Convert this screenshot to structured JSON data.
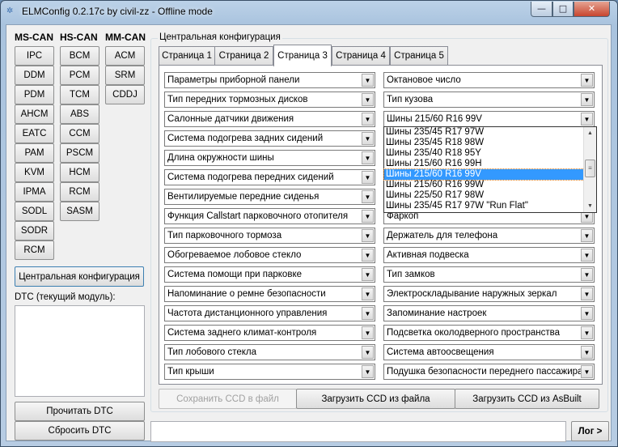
{
  "window": {
    "title": "ELMConfig 0.2.17c by civil-zz - Offline mode",
    "min": "—",
    "max": "□",
    "close": "✕"
  },
  "modules": {
    "ms_can": {
      "label": "MS-CAN",
      "items": [
        "IPC",
        "DDM",
        "PDM",
        "AHCM",
        "EATC",
        "PAM",
        "KVM",
        "IPMA",
        "SODL",
        "SODR",
        "RCM"
      ]
    },
    "hs_can": {
      "label": "HS-CAN",
      "items": [
        "BCM",
        "PCM",
        "TCM",
        "ABS",
        "CCM",
        "PSCM",
        "HCM",
        "RCM",
        "SASM"
      ]
    },
    "mm_can": {
      "label": "MM-CAN",
      "items": [
        "ACM",
        "SRM",
        "CDDJ"
      ]
    }
  },
  "left": {
    "central_config_button": "Центральная конфигурация",
    "dtc_label": "DTC (текущий модуль):",
    "dtc_text": "",
    "read_dtc": "Прочитать DTC",
    "reset_dtc": "Сбросить DTC"
  },
  "group": {
    "label": "Центральная конфигурация",
    "tabs": [
      "Страница 1",
      "Страница 2",
      "Страница 3",
      "Страница 4",
      "Страница 5"
    ],
    "selected_tab": 2,
    "left_combos": [
      "Параметры приборной панели",
      "Тип передних тормозных дисков",
      "Салонные датчики движения",
      "Система подогрева задних сидений",
      "Длина окружности шины",
      "Система подогрева передних сидений",
      "Вентилируемые передние сиденья",
      "Функция Callstart парковочного отопителя",
      "Тип парковочного тормоза",
      "Обогреваемое лобовое стекло",
      "Система помощи при парковке",
      "Напоминание о ремне безопасности",
      "Частота дистанционного управления",
      "Система заднего климат-контроля",
      "Тип лобового стекла",
      "Тип крыши"
    ],
    "right_combos": [
      "Октановое число",
      "Тип кузова",
      "Шины 215/60 R16 99V",
      "",
      "",
      "",
      "",
      "Фаркоп",
      "Держатель для телефона",
      "Активная подвеска",
      "Тип замков",
      "Электроскладывание наружных зеркал",
      "Запоминание настроек",
      "Подсветка околодверного пространства",
      "Система автоосвещения",
      "Подушка безопасности переднего пассажира"
    ],
    "dropdown": {
      "items": [
        "Шины 235/45 R17 97W",
        "Шины 235/45 R18 98W",
        "Шины 235/40 R18 95Y",
        "Шины 215/60 R16 99H",
        "Шины 215/60 R16 99V",
        "Шины 215/60 R16 99W",
        "Шины 225/50 R17 98W",
        "Шины 235/45 R17 97W \"Run Flat\""
      ],
      "selected_index": 4
    },
    "buttons": {
      "save": "Сохранить CCD в файл",
      "load_file": "Загрузить CCD из файла",
      "load_asbuilt": "Загрузить CCD из AsBuilt"
    }
  },
  "bottom": {
    "status": "",
    "log": "Лог >"
  }
}
